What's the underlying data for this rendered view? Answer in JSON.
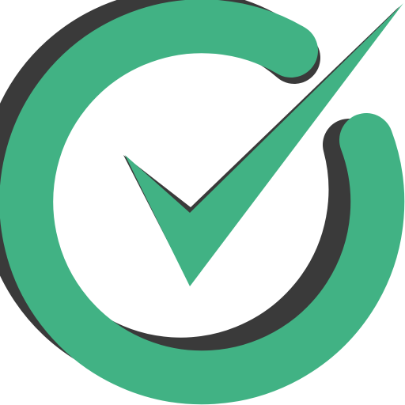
{
  "logo": {
    "icon": "check-circle-icon",
    "colors": {
      "primary": "#41B284",
      "shadow": "#3A3A3A",
      "background": "#FFFFFF"
    }
  }
}
